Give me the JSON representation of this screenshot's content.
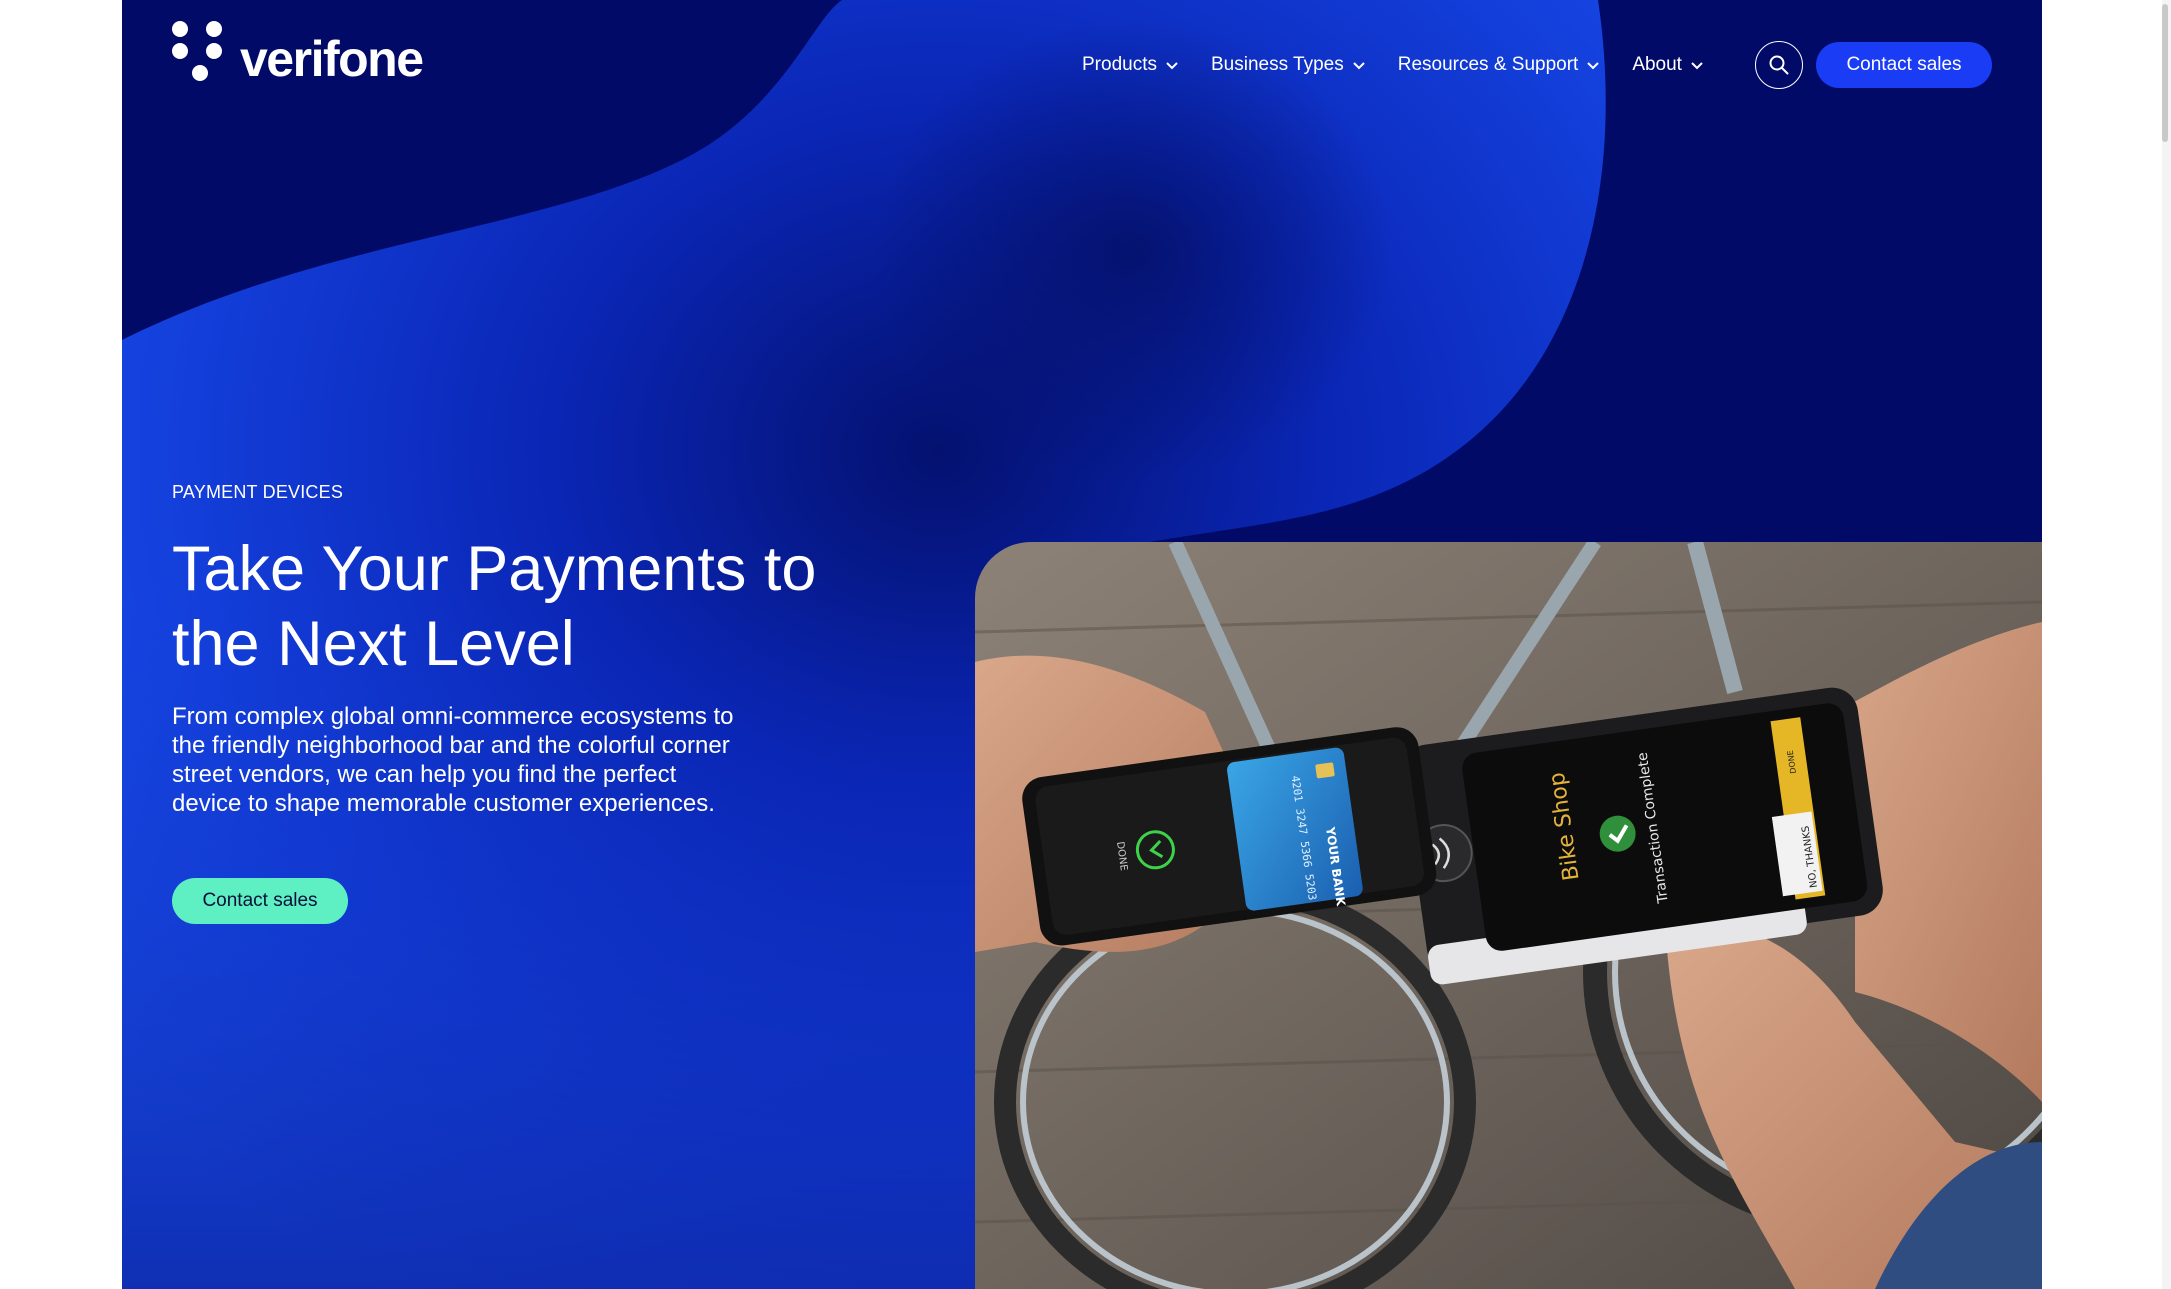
{
  "brand": {
    "name": "verifone",
    "primary_navy": "#020a68",
    "accent_blue": "#1a3cf5",
    "accent_mint": "#5ef0c2"
  },
  "header": {
    "nav": [
      {
        "label": "Products",
        "icon": "chevron-down-icon"
      },
      {
        "label": "Business Types",
        "icon": "chevron-down-icon"
      },
      {
        "label": "Resources & Support",
        "icon": "chevron-down-icon"
      },
      {
        "label": "About",
        "icon": "chevron-down-icon"
      }
    ],
    "search_icon": "search-icon",
    "contact_label": "Contact sales"
  },
  "hero": {
    "eyebrow": "PAYMENT DEVICES",
    "title": "Take Your Payments to the Next Level",
    "body": "From complex global omni-commerce ecosystems to the friendly neighborhood bar and the colorful corner street vendors, we can help you find the perfect device to shape memorable customer experiences.",
    "cta_label": "Contact sales"
  },
  "hero_image": {
    "card_text": "YOUR BANK",
    "card_number": "4201 3247 5366 5203",
    "phone_screen_label": "DONE",
    "terminal_brand": "Bike Shop",
    "terminal_status": "Transaction Complete",
    "terminal_button": "NO, THANKS",
    "terminal_side_label": "DONE"
  }
}
